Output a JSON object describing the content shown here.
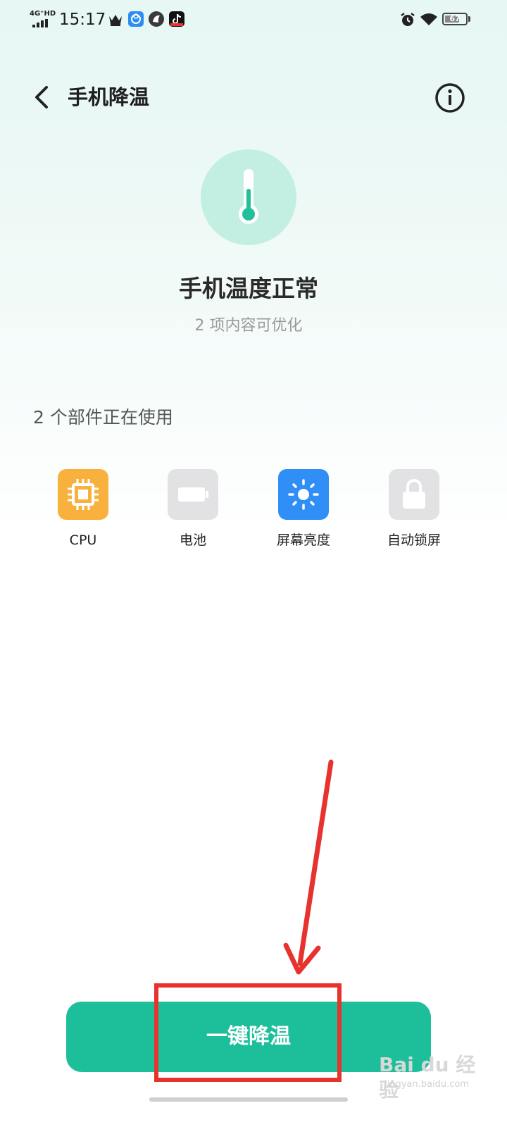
{
  "status_bar": {
    "network": "4G⁺HD",
    "time": "15:17",
    "battery": "67",
    "icons": [
      "crown-icon",
      "app-icon",
      "app-icon",
      "tiktok-icon",
      "alarm-icon",
      "wifi-icon",
      "battery-icon"
    ]
  },
  "header": {
    "title": "手机降温",
    "back_icon": "chevron-left-icon",
    "info_icon": "info-icon"
  },
  "hero": {
    "icon": "thermometer-icon",
    "status": "手机温度正常",
    "subtitle": "2 项内容可优化"
  },
  "section": {
    "title": "2 个部件正在使用"
  },
  "components": [
    {
      "label": "CPU",
      "icon": "cpu-chip-icon",
      "color": "#f7b13c",
      "active": true
    },
    {
      "label": "电池",
      "icon": "battery-icon",
      "color": "#e2e2e4",
      "active": false
    },
    {
      "label": "屏幕亮度",
      "icon": "sun-icon",
      "color": "#2f8ff6",
      "active": true
    },
    {
      "label": "自动锁屏",
      "icon": "lock-icon",
      "color": "#e2e2e4",
      "active": false
    }
  ],
  "action": {
    "label": "一键降温"
  },
  "watermark": {
    "main": "Bai du 经验",
    "sub": "jingyan.baidu.com"
  },
  "colors": {
    "accent": "#1dbf9b",
    "thermo_circle": "#c3efe3",
    "annotation": "#e8322e"
  }
}
